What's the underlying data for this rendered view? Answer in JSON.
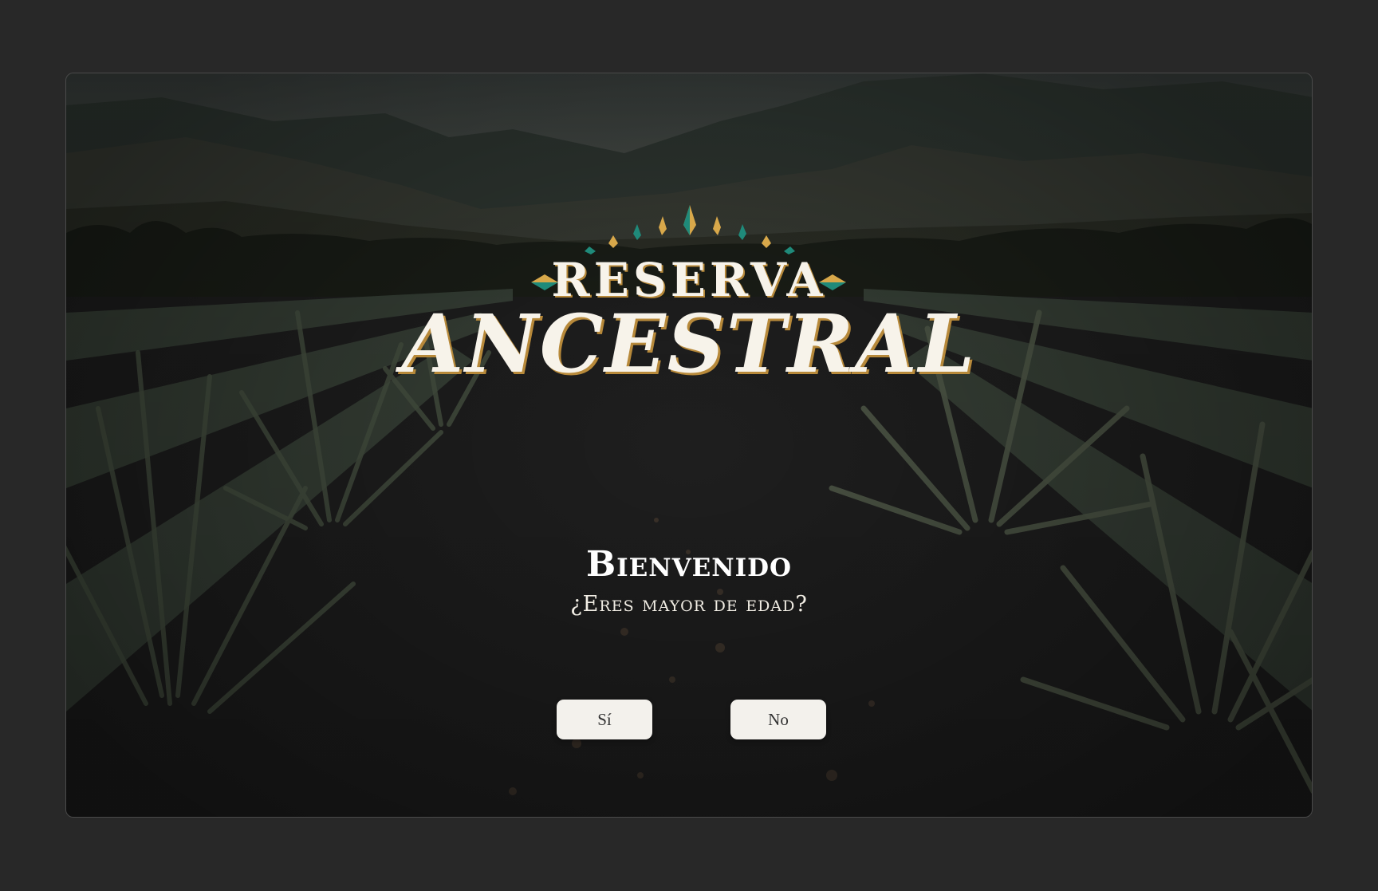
{
  "brand": {
    "line1": "RESERVA",
    "line2": "ANCESTRAL"
  },
  "age_gate": {
    "title": "Bienvenido",
    "question": "¿Eres mayor de edad?",
    "yes_label": "Sí",
    "no_label": "No"
  },
  "colors": {
    "page_background": "#282828",
    "logo_text": "#f7f3ea",
    "logo_accent_gold": "#d8a84a",
    "logo_accent_teal": "#1f8a7a",
    "button_background": "#f3f1ec",
    "button_text": "#333333"
  }
}
